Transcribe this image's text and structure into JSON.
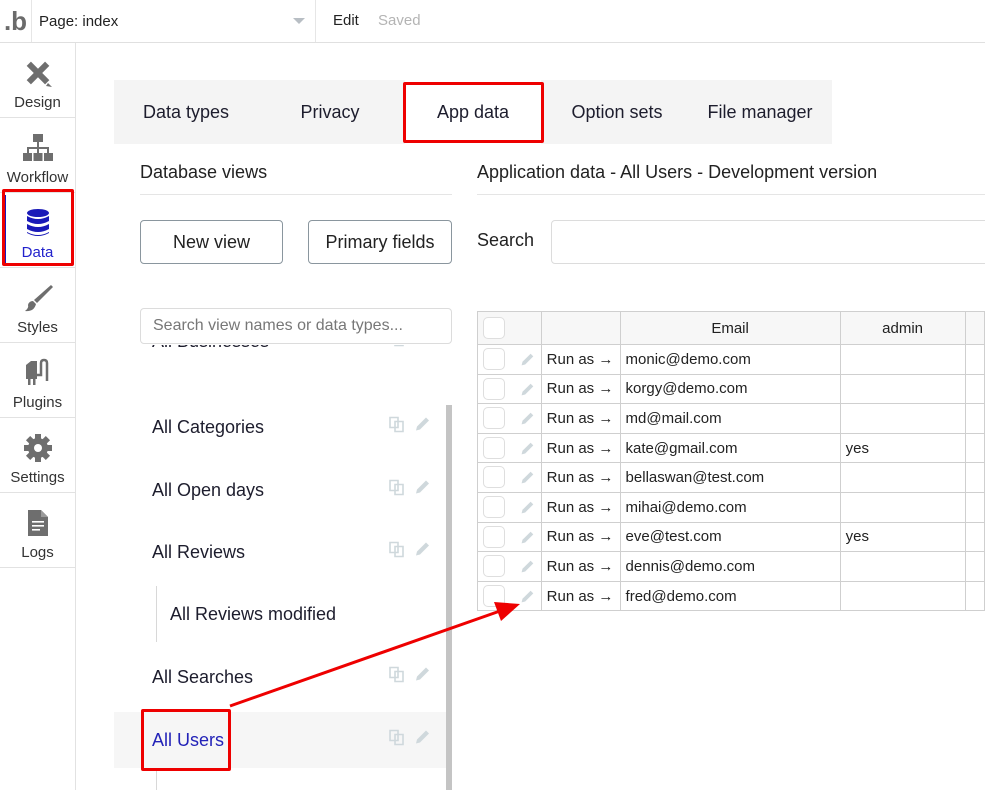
{
  "topbar": {
    "logo": ".b",
    "page_selector": "Page: index",
    "edit_label": "Edit",
    "status": "Saved"
  },
  "sidebar": {
    "items": [
      {
        "label": "Design",
        "icon": "design-icon"
      },
      {
        "label": "Workflow",
        "icon": "workflow-icon"
      },
      {
        "label": "Data",
        "icon": "database-icon",
        "active": true
      },
      {
        "label": "Styles",
        "icon": "brush-icon"
      },
      {
        "label": "Plugins",
        "icon": "plug-icon"
      },
      {
        "label": "Settings",
        "icon": "gear-icon"
      },
      {
        "label": "Logs",
        "icon": "document-icon"
      }
    ]
  },
  "tabs": [
    {
      "label": "Data types"
    },
    {
      "label": "Privacy"
    },
    {
      "label": "App data",
      "active": true
    },
    {
      "label": "Option sets"
    },
    {
      "label": "File manager"
    }
  ],
  "database_views": {
    "title": "Database views",
    "new_view_button": "New view",
    "primary_fields_button": "Primary fields",
    "search_placeholder": "Search view names or data types...",
    "items": [
      {
        "label": "All Businesses",
        "partially_hidden": true
      },
      {
        "label": "All Categories"
      },
      {
        "label": "All Open days"
      },
      {
        "label": "All Reviews"
      },
      {
        "label": "All Reviews modified",
        "sub": true
      },
      {
        "label": "All Searches"
      },
      {
        "label": "All Users",
        "selected": true
      }
    ]
  },
  "app_data": {
    "title": "Application data - All Users - Development version",
    "search_label": "Search",
    "search_value": "",
    "columns": [
      "",
      "",
      "Email",
      "admin"
    ],
    "run_as_label": "Run as →",
    "rows": [
      {
        "email": "monic@demo.com",
        "admin": ""
      },
      {
        "email": "korgy@demo.com",
        "admin": ""
      },
      {
        "email": "md@mail.com",
        "admin": ""
      },
      {
        "email": "kate@gmail.com",
        "admin": "yes"
      },
      {
        "email": "bellaswan@test.com",
        "admin": ""
      },
      {
        "email": "mihai@demo.com",
        "admin": ""
      },
      {
        "email": "eve@test.com",
        "admin": "yes"
      },
      {
        "email": "dennis@demo.com",
        "admin": ""
      },
      {
        "email": "fred@demo.com",
        "admin": ""
      }
    ]
  },
  "colors": {
    "accent": "#2323b8",
    "annotation": "#ee0000",
    "icon_gray": "#6e6e6e",
    "row_icon": "#cfd8dc"
  }
}
